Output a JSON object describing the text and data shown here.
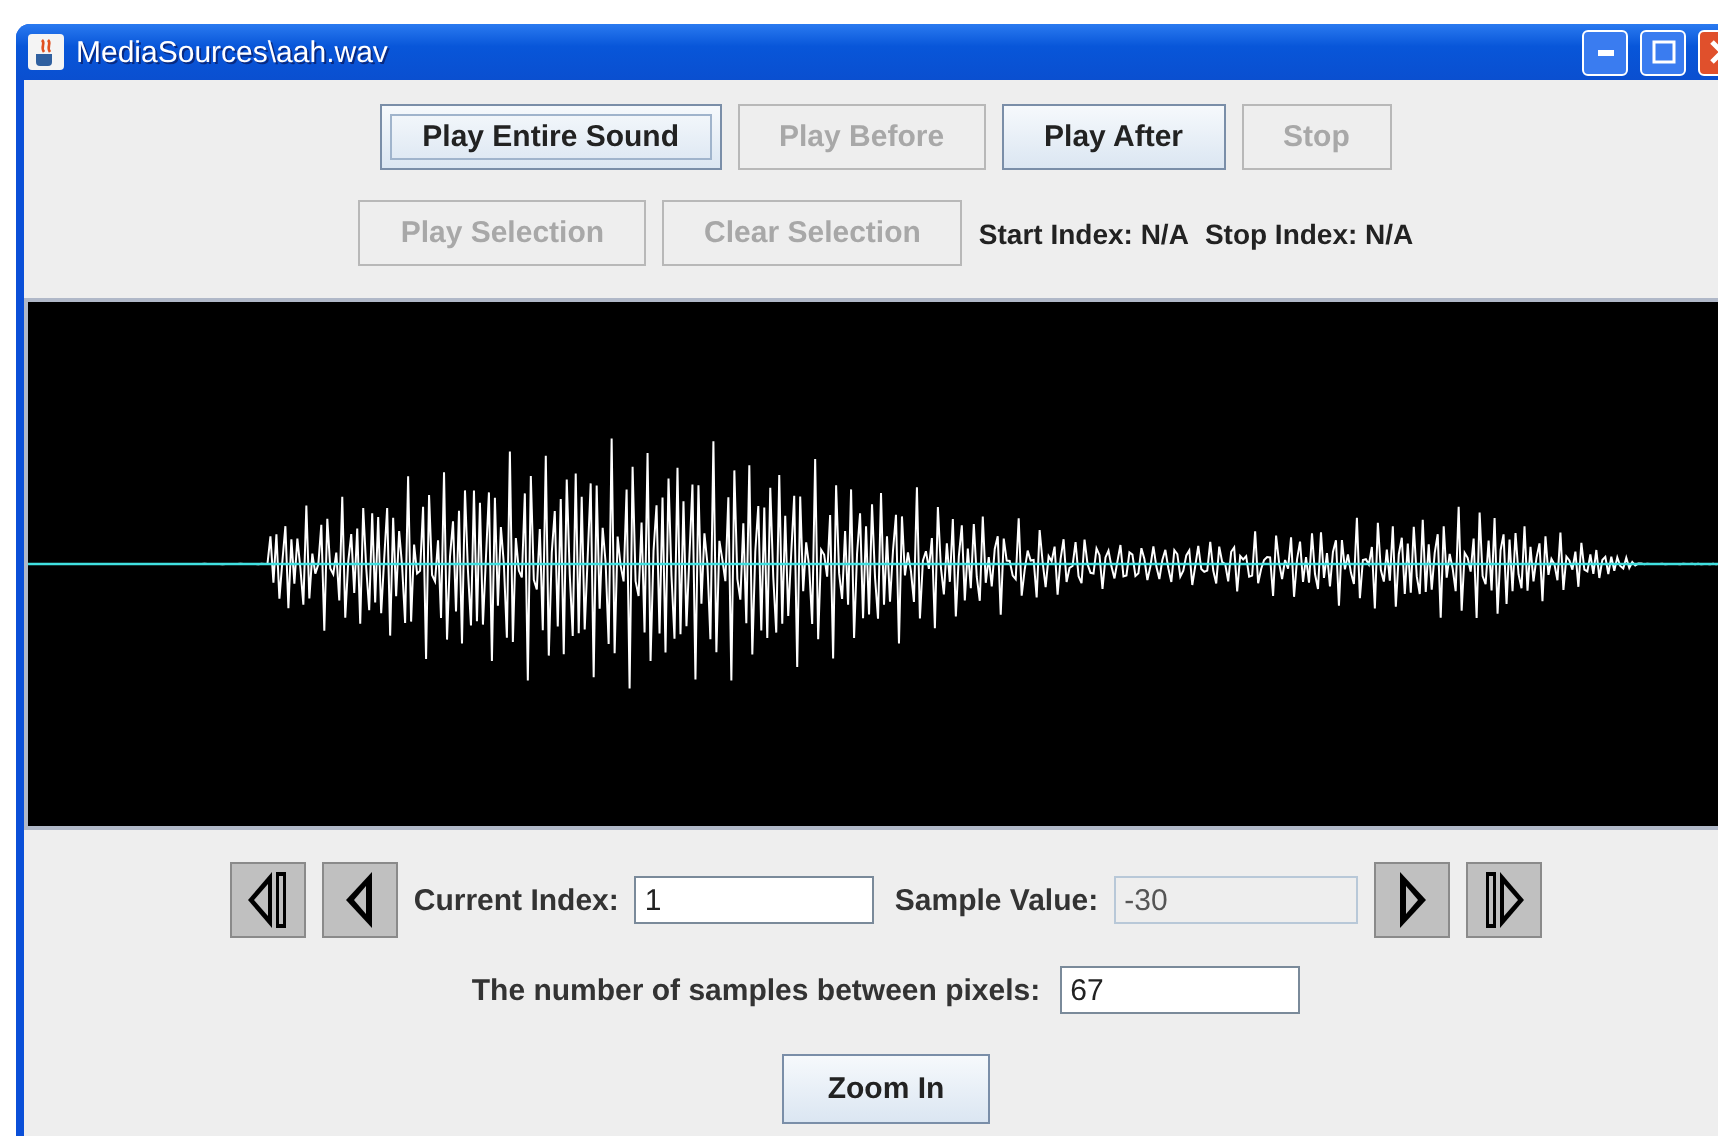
{
  "window": {
    "title": "MediaSources\\aah.wav"
  },
  "top_buttons": [
    {
      "label": "Play Entire Sound",
      "disabled": false,
      "focused": true
    },
    {
      "label": "Play Before",
      "disabled": true,
      "focused": false
    },
    {
      "label": "Play After",
      "disabled": false,
      "focused": false
    },
    {
      "label": "Stop",
      "disabled": true,
      "focused": false
    }
  ],
  "selection_buttons": [
    {
      "label": "Play Selection",
      "disabled": true
    },
    {
      "label": "Clear Selection",
      "disabled": true
    }
  ],
  "index_info": [
    {
      "label": "Start Index: N/A"
    },
    {
      "label": "Stop Index: N/A"
    }
  ],
  "navigation": {
    "current_index": {
      "label": "Current Index:",
      "value": "1",
      "disabled": false
    },
    "sample_value": {
      "label": "Sample Value:",
      "value": "-30",
      "disabled": true
    }
  },
  "samples_between_pixels": {
    "label": "The number of samples between pixels:",
    "value": "67"
  },
  "zoom_button": {
    "label": "Zoom In"
  }
}
